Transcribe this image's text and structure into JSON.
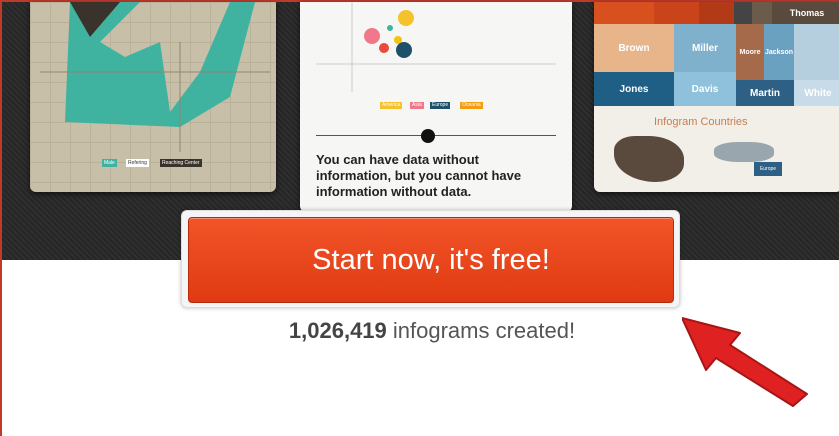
{
  "showcase": {
    "left_card": {
      "legend": [
        "Male",
        "Refering",
        "Reaching Center"
      ]
    },
    "middle_card": {
      "quote": "You can have data without information, but you cannot have information without data.",
      "legend": [
        "America",
        "Asia",
        "Europe",
        "Oceania"
      ]
    },
    "right_card": {
      "tiles": [
        "Thomas",
        "Brown",
        "Miller",
        "Jones",
        "Davis",
        "Martin",
        "White",
        "Jackson",
        "Moore"
      ],
      "title": "Infogram Countries",
      "map_label": "Europe"
    }
  },
  "cta": {
    "button_label": "Start now, it's free!",
    "count": "1,026,419",
    "count_suffix": " infograms created!"
  },
  "colors": {
    "cta": "#e84a1f",
    "arrow": "#e02121",
    "teal": "#3fb3a0"
  }
}
